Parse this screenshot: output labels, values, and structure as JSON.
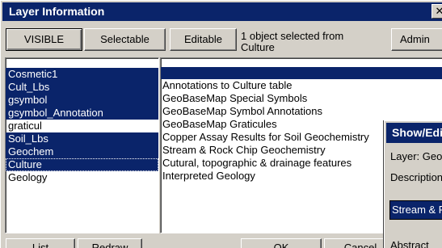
{
  "window": {
    "title": "Layer Information",
    "close_glyph": "✕"
  },
  "toolbar": {
    "visible_label": "VISIBLE",
    "selectable_label": "Selectable",
    "editable_label": "Editable",
    "status_line1": "1 object selected from",
    "status_line2": "Culture",
    "admin_label": "Admin"
  },
  "layers": [
    {
      "label": "Cosmetic1",
      "selected": true
    },
    {
      "label": "Cult_Lbs",
      "selected": true
    },
    {
      "label": "gsymbol",
      "selected": true
    },
    {
      "label": "gsymbol_Annotation",
      "selected": true
    },
    {
      "label": "graticul",
      "selected": false
    },
    {
      "label": "Soil_Lbs",
      "selected": true
    },
    {
      "label": "Geochem",
      "selected": true
    },
    {
      "label": "Culture",
      "selected": true,
      "focused": true
    },
    {
      "label": "Geology",
      "selected": false
    }
  ],
  "descriptions": [
    "Annotations to Culture table",
    "GeoBaseMap Special Symbols",
    "GeoBaseMap Symbol Annotations",
    "GeoBaseMap Graticules",
    "Copper Assay Results for Soil Geochemistry",
    "Stream & Rock Chip Geochemistry",
    "Cutural, topographic & drainage features",
    "Interpreted Geology"
  ],
  "footer": {
    "list_label": "List",
    "redraw_label": "Redraw",
    "ok_label": "OK",
    "cancel_label": "Cancel"
  },
  "overlay": {
    "title": "Show/Edit",
    "layer_label": "Layer: Geochem",
    "description_label": "Description",
    "description_value": "Stream & Rock Chip",
    "abstract_label": "Abstract"
  }
}
